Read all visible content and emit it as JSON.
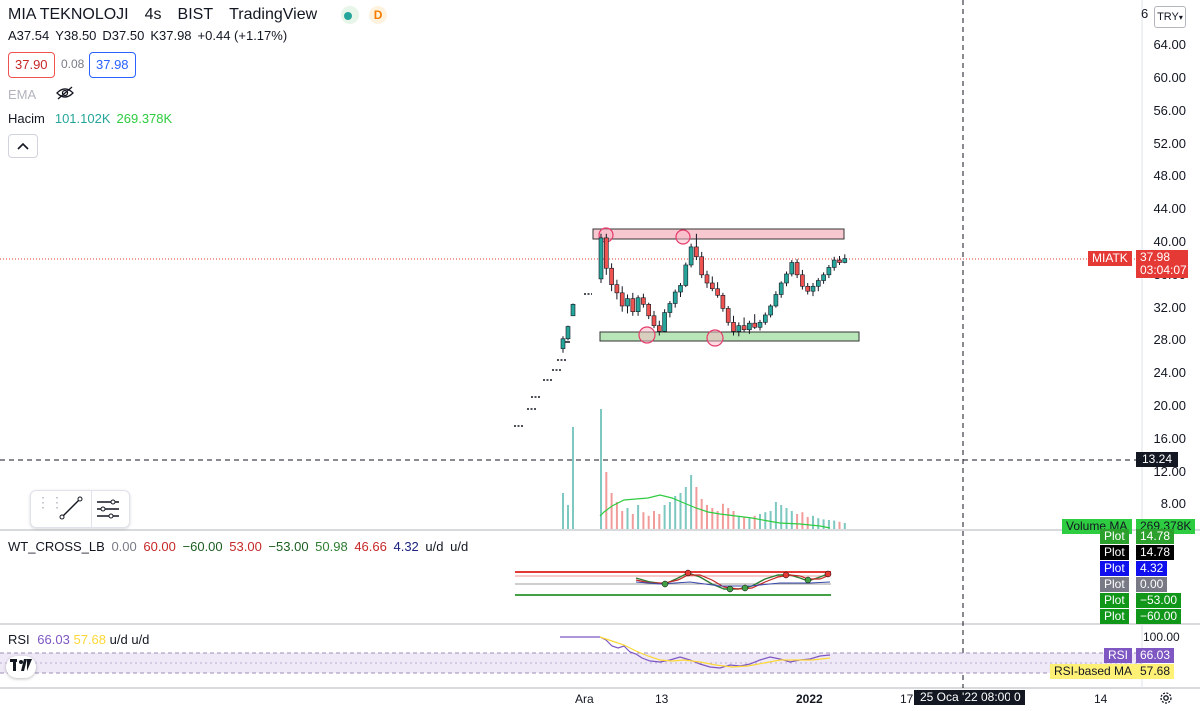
{
  "header": {
    "symbol_name": "MIA TEKNOLOJI",
    "interval": "4s",
    "exchange": "BIST",
    "source": "TradingView",
    "badge_d": "D",
    "ohlc": {
      "open": "A37.54",
      "high": "Y38.50",
      "low": "D37.50",
      "close": "K37.98",
      "change": "+0.44 (+1.17%)"
    },
    "bid": "37.90",
    "spread": "0.08",
    "ask": "37.98",
    "ema_label": "EMA",
    "volume_label": "Hacim",
    "volume_value1": "101.102K",
    "volume_value2": "269.378K",
    "currency": "TRY"
  },
  "price_axis": {
    "labels": [
      "64.00",
      "60.00",
      "56.00",
      "52.00",
      "48.00",
      "44.00",
      "40.00",
      "36.00",
      "32.00",
      "28.00",
      "24.00",
      "20.00",
      "16.00",
      "12.00",
      "8.00"
    ],
    "top_label": "6",
    "crosshair_value": "13.24",
    "symbol_tag": "MIATK",
    "last_price": "37.98",
    "countdown": "03:04:07",
    "volume_ma_label": "Volume MA",
    "volume_ma_value": "269.378K"
  },
  "wt_cross": {
    "name": "WT_CROSS_LB",
    "values": [
      {
        "text": "0.00",
        "color": "#787b86"
      },
      {
        "text": "60.00",
        "color": "#c62828"
      },
      {
        "text": "−60.00",
        "color": "#1b5e20"
      },
      {
        "text": "53.00",
        "color": "#c62828"
      },
      {
        "text": "−53.00",
        "color": "#1b5e20"
      },
      {
        "text": "50.98",
        "color": "#2e7d32"
      },
      {
        "text": "46.66",
        "color": "#c62828"
      },
      {
        "text": "4.32",
        "color": "#1a237e"
      },
      {
        "text": "u/d",
        "color": "#131722"
      },
      {
        "text": "u/d",
        "color": "#131722"
      }
    ],
    "plot_tags": [
      {
        "label": "Plot",
        "value": "14.78",
        "color": "#2ca02c"
      },
      {
        "label": "Plot",
        "value": "14.78",
        "color": "#000000"
      },
      {
        "label": "Plot",
        "value": "4.32",
        "color": "#1010ee"
      },
      {
        "label": "Plot",
        "value": "0.00",
        "color": "#787b86"
      },
      {
        "label": "Plot",
        "value": "−53.00",
        "color": "#109618"
      },
      {
        "label": "Plot",
        "value": "−60.00",
        "color": "#109618"
      }
    ]
  },
  "rsi": {
    "name": "RSI",
    "value1": "66.03",
    "value2": "57.68",
    "ud1": "u/d",
    "ud2": "u/d",
    "axis_top": "100.00",
    "tag_rsi_label": "RSI",
    "tag_rsi_value": "66.03",
    "tag_ma_label": "RSI-based MA",
    "tag_ma_value": "57.68"
  },
  "time_axis": {
    "labels": [
      "Ara",
      "13",
      "2022",
      "17",
      "14"
    ],
    "crosshair_time": "25 Oca '22  08:00",
    "crosshair_extra": "0"
  },
  "colors": {
    "up": "#26a69a",
    "down": "#ef5350",
    "resistance_zone": "#f8c8d0",
    "support_zone": "#b9e6b9",
    "last_price_tag": "#e53935"
  }
}
